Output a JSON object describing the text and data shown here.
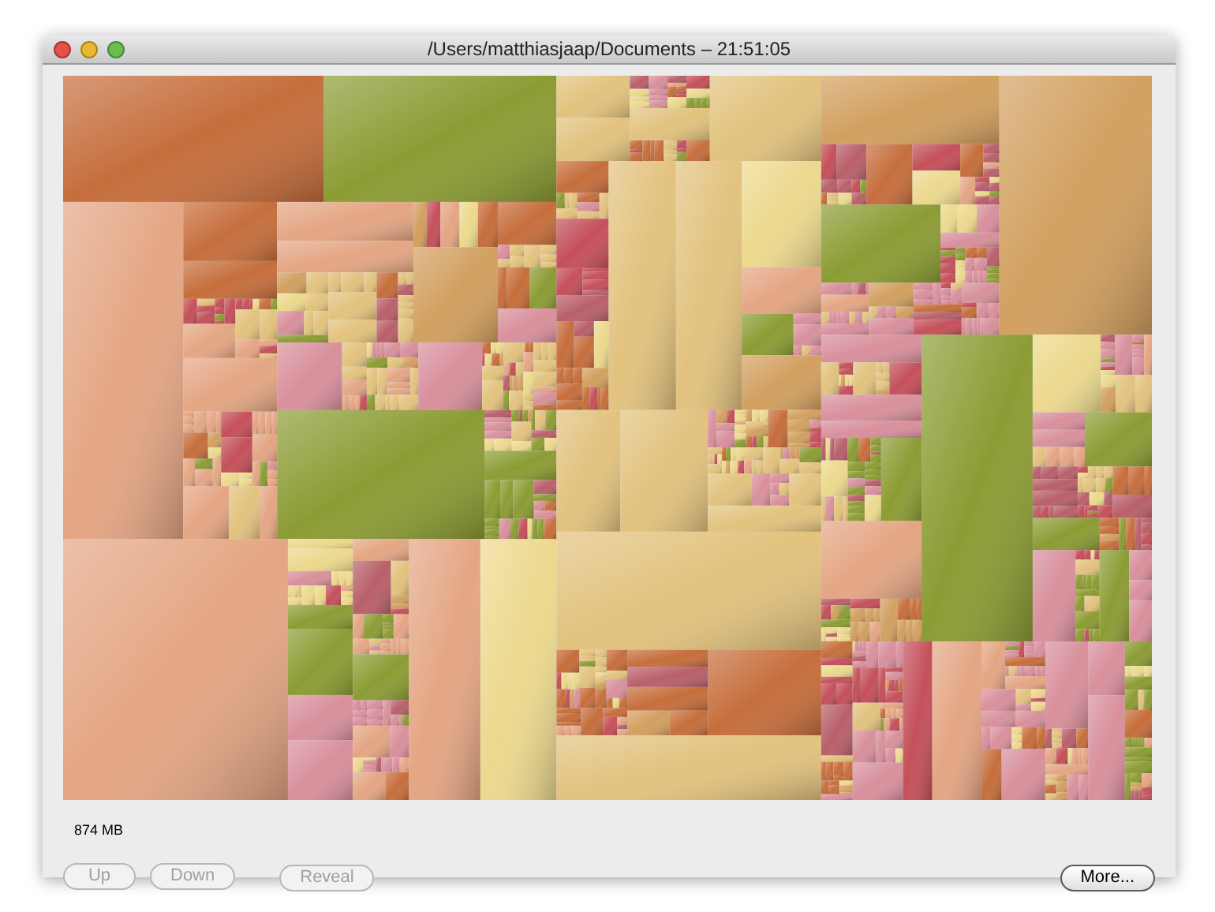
{
  "window": {
    "title": "/Users/matthiasjaap/Documents – 21:51:05"
  },
  "size_label": "874 MB",
  "buttons": [
    {
      "label": "Up",
      "disabled": true
    },
    {
      "label": "Down",
      "disabled": true
    },
    {
      "label": "Reveal",
      "disabled": true
    },
    {
      "label": "More...",
      "disabled": false
    }
  ]
}
